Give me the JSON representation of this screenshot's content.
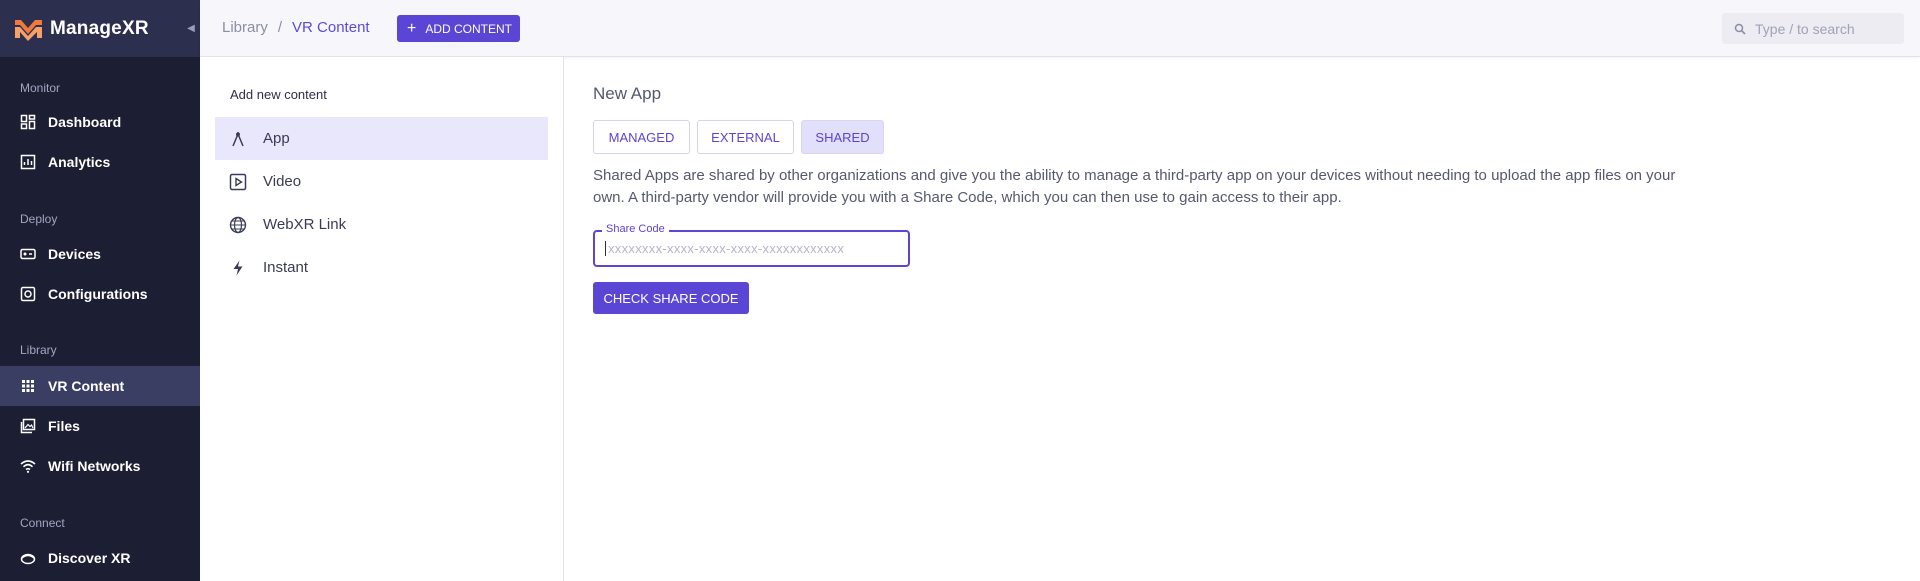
{
  "app": {
    "brand": "ManageXR"
  },
  "sidebar": {
    "sections": [
      {
        "label": "Monitor"
      },
      {
        "label": "Deploy"
      },
      {
        "label": "Library"
      },
      {
        "label": "Connect"
      }
    ],
    "items": [
      {
        "label": "Dashboard"
      },
      {
        "label": "Analytics"
      },
      {
        "label": "Devices"
      },
      {
        "label": "Configurations"
      },
      {
        "label": "VR Content"
      },
      {
        "label": "Files"
      },
      {
        "label": "Wifi Networks"
      },
      {
        "label": "Discover XR"
      }
    ],
    "active_item": "VR Content"
  },
  "topbar": {
    "breadcrumb": {
      "root": "Library",
      "separator": "/",
      "current": "VR Content"
    },
    "add_button": {
      "label": "ADD CONTENT"
    },
    "search": {
      "placeholder": "Type / to search"
    }
  },
  "content_types": {
    "title": "Add new content",
    "items": [
      {
        "label": "App"
      },
      {
        "label": "Video"
      },
      {
        "label": "WebXR Link"
      },
      {
        "label": "Instant"
      }
    ],
    "active_item": "App"
  },
  "main": {
    "title": "New App",
    "tabs": [
      {
        "label": "MANAGED"
      },
      {
        "label": "EXTERNAL"
      },
      {
        "label": "SHARED"
      }
    ],
    "active_tab": "SHARED",
    "description": "Shared Apps are shared by other organizations and give you the ability to manage a third-party app on your devices without needing to upload the app files on your own. A third-party vendor will provide you with a Share Code, which you can then use to gain access to their app.",
    "share_code": {
      "label": "Share Code",
      "placeholder": "xxxxxxxx-xxxx-xxxx-xxxx-xxxxxxxxxxxx",
      "value": ""
    },
    "check_button": {
      "label": "CHECK SHARE CODE"
    }
  },
  "colors": {
    "accent": "#5b45d4",
    "sidebar_bg": "#1c1e33",
    "sidebar_active": "#3b3e63",
    "logo_orange": "#f0793b"
  }
}
